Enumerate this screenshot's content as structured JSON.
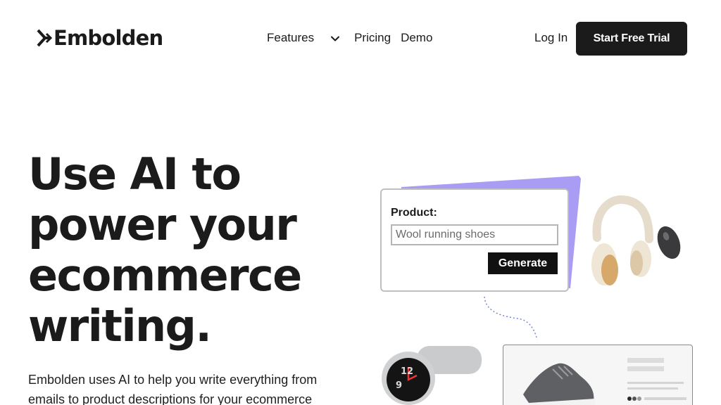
{
  "brand": {
    "name": "Embolden",
    "logo_icon": "arrow-chevron-mark"
  },
  "nav": {
    "features": "Features",
    "features_icon": "chevron-down-icon",
    "pricing": "Pricing",
    "demo": "Demo"
  },
  "header": {
    "login": "Log In",
    "cta": "Start Free Trial"
  },
  "hero": {
    "title": "Use AI to\npower your\necommerce\nwriting.",
    "subtitle": "Embolden uses AI to help you write everything from emails to product descriptions for your ecommerce"
  },
  "demo_card": {
    "label": "Product:",
    "input_value": "Wool running shoes",
    "button": "Generate"
  },
  "colors": {
    "accent": "#a99cf5",
    "primary": "#1b1b1b"
  }
}
